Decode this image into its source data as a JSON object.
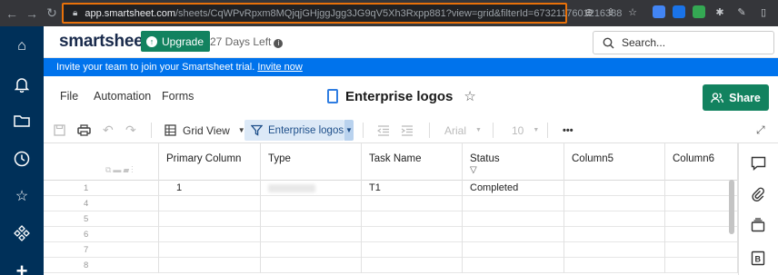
{
  "browser": {
    "url_host": "app.smartsheet.com",
    "url_path": "/sheets/CqWPvRpxm8MQjqjGHjggJgg3JG9qV5Xh3Rxpp881?view=grid&filterId=6732117601216388"
  },
  "header": {
    "logo": "smartsheet",
    "upgrade_label": "Upgrade",
    "trial_text": "27 Days Left",
    "search_placeholder": "Search..."
  },
  "banner": {
    "text": "Invite your team to join your Smartsheet trial.",
    "link": "Invite now"
  },
  "menu": {
    "file": "File",
    "automation": "Automation",
    "forms": "Forms",
    "sheet_name": "Enterprise logos",
    "share_label": "Share"
  },
  "toolbar": {
    "view_label": "Grid View",
    "filter_label": "Enterprise logos",
    "font_label": "Arial",
    "size_label": "10",
    "more_label": "•••"
  },
  "grid": {
    "columns": [
      "Primary Column",
      "Type",
      "Task Name",
      "Status",
      "Column5",
      "Column6"
    ],
    "rows": [
      {
        "num": "1",
        "primary": "1",
        "type": "",
        "task": "T1",
        "status": "Completed"
      },
      {
        "num": "4",
        "primary": "",
        "type": "",
        "task": "",
        "status": ""
      },
      {
        "num": "5",
        "primary": "",
        "type": "",
        "task": "",
        "status": ""
      },
      {
        "num": "6",
        "primary": "",
        "type": "",
        "task": "",
        "status": ""
      },
      {
        "num": "7",
        "primary": "",
        "type": "",
        "task": "",
        "status": ""
      },
      {
        "num": "8",
        "primary": "",
        "type": "",
        "task": "",
        "status": ""
      }
    ]
  },
  "icons": {
    "rail": [
      "home-icon",
      "bell-icon",
      "folder-icon",
      "clock-icon",
      "star-icon",
      "apps-icon",
      "plus-icon"
    ],
    "right_panel": [
      "comment-icon",
      "attachment-icon",
      "proofing-icon",
      "summary-icon"
    ]
  },
  "colors": {
    "rail": "#003059",
    "banner": "#0073ec",
    "brand_green": "#12825f",
    "filter_highlight": "#dce9f7"
  }
}
